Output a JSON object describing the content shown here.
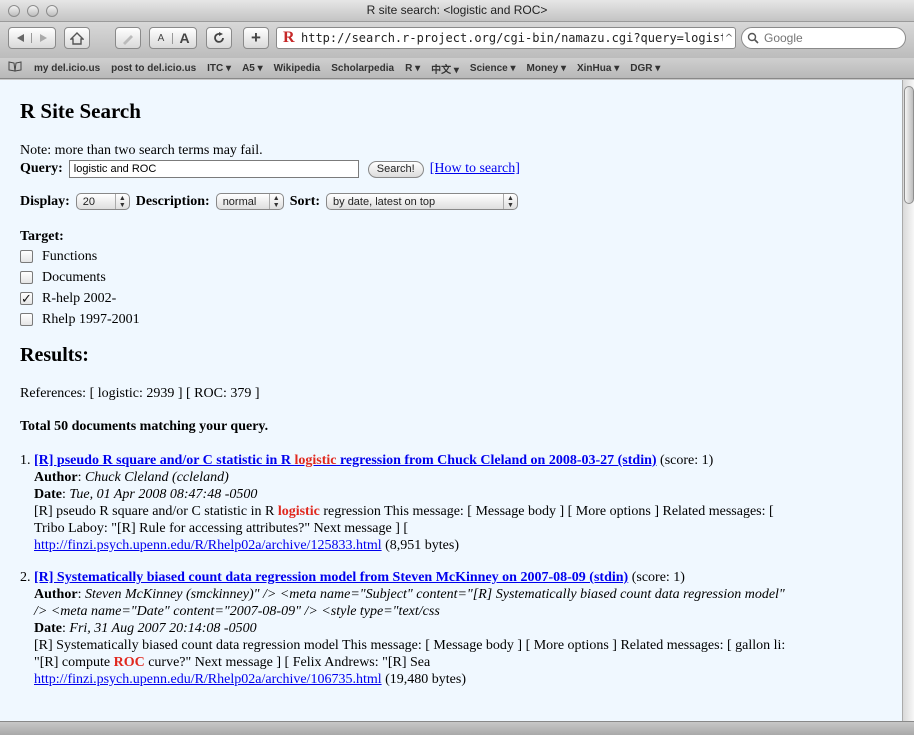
{
  "window": {
    "title": "R site search: <logistic and ROC>"
  },
  "toolbar": {
    "back_icon": "back-arrow-icon",
    "forward_icon": "forward-arrow-icon",
    "text_smaller": "A",
    "text_bigger": "A",
    "url": "http://search.r-project.org/cgi-bin/namazu.cgi?query=logistic+and+ROC&",
    "search_placeholder": "Google"
  },
  "bookmarks": [
    "my del.icio.us",
    "post to del.icio.us",
    "ITC ▾",
    "A5 ▾",
    "Wikipedia",
    "Scholarpedia",
    "R ▾",
    "中文 ▾",
    "Science ▾",
    "Money ▾",
    "XinHua ▾",
    "DGR ▾"
  ],
  "page": {
    "title": "R Site Search",
    "note": "Note: more than two search terms may fail.",
    "query_label": "Query:",
    "query_value": "logistic and ROC",
    "search_button": "Search!",
    "how_to_link": "[How to search]",
    "display_label": "Display:",
    "display_value": "20",
    "description_label": "Description:",
    "description_value": "normal",
    "sort_label": "Sort:",
    "sort_value": "by date, latest on top",
    "target_label": "Target:",
    "targets": [
      {
        "label": "Functions",
        "checked": false
      },
      {
        "label": "Documents",
        "checked": false
      },
      {
        "label": "R-help 2002-",
        "checked": true
      },
      {
        "label": "Rhelp 1997-2001",
        "checked": false
      }
    ],
    "results_title": "Results:",
    "references": "References: [ logistic: 2939 ] [ ROC: 379 ]",
    "total": "Total 50 documents matching your query."
  },
  "results": [
    {
      "num": "1.",
      "title_pre": "[R] pseudo R square and/or C statistic in R ",
      "title_hl": "logistic",
      "title_post": " regression from Chuck Cleland on 2008-03-27 (stdin)",
      "score": "(score: 1)",
      "author_label": "Author",
      "author": "Chuck Cleland (ccleland)",
      "date_label": "Date",
      "date": "Tue, 01 Apr 2008 08:47:48 -0500",
      "body_pre": "[R] pseudo R square and/or C statistic in R ",
      "body_hl": "logistic",
      "body_post": " regression This message: [ Message body ] [ More options ] Related messages: [",
      "body_line2": "Tribo Laboy: \"[R] Rule for accessing attributes?\" Next message ] [",
      "url": "http://finzi.psych.upenn.edu/R/Rhelp02a/archive/125833.html",
      "size": "(8,951 bytes)"
    },
    {
      "num": "2.",
      "title_pre": "[R] Systematically biased count data regression model from Steven McKinney on 2007-08-09 (stdin)",
      "title_hl": "",
      "title_post": "",
      "score": "(score: 1)",
      "author_label": "Author",
      "author": "Steven McKinney (smckinney)\" /> <meta name=\"Subject\" content=\"[R] Systematically biased count data regression model\"",
      "author_line2": "/> <meta name=\"Date\" content=\"2007-08-09\" /> <style type=\"text/css",
      "date_label": "Date",
      "date": "Fri, 31 Aug 2007 20:14:08 -0500",
      "body_pre": "[R] Systematically biased count data regression model This message: [ Message body ] [ More options ] Related messages: [ gallon li:",
      "body_line2_pre": "\"[R] compute ",
      "body_hl": "ROC",
      "body_line2_post": " curve?\" Next message ] [ Felix Andrews: \"[R] Sea",
      "url": "http://finzi.psych.upenn.edu/R/Rhelp02a/archive/106735.html",
      "size": "(19,480 bytes)"
    }
  ]
}
